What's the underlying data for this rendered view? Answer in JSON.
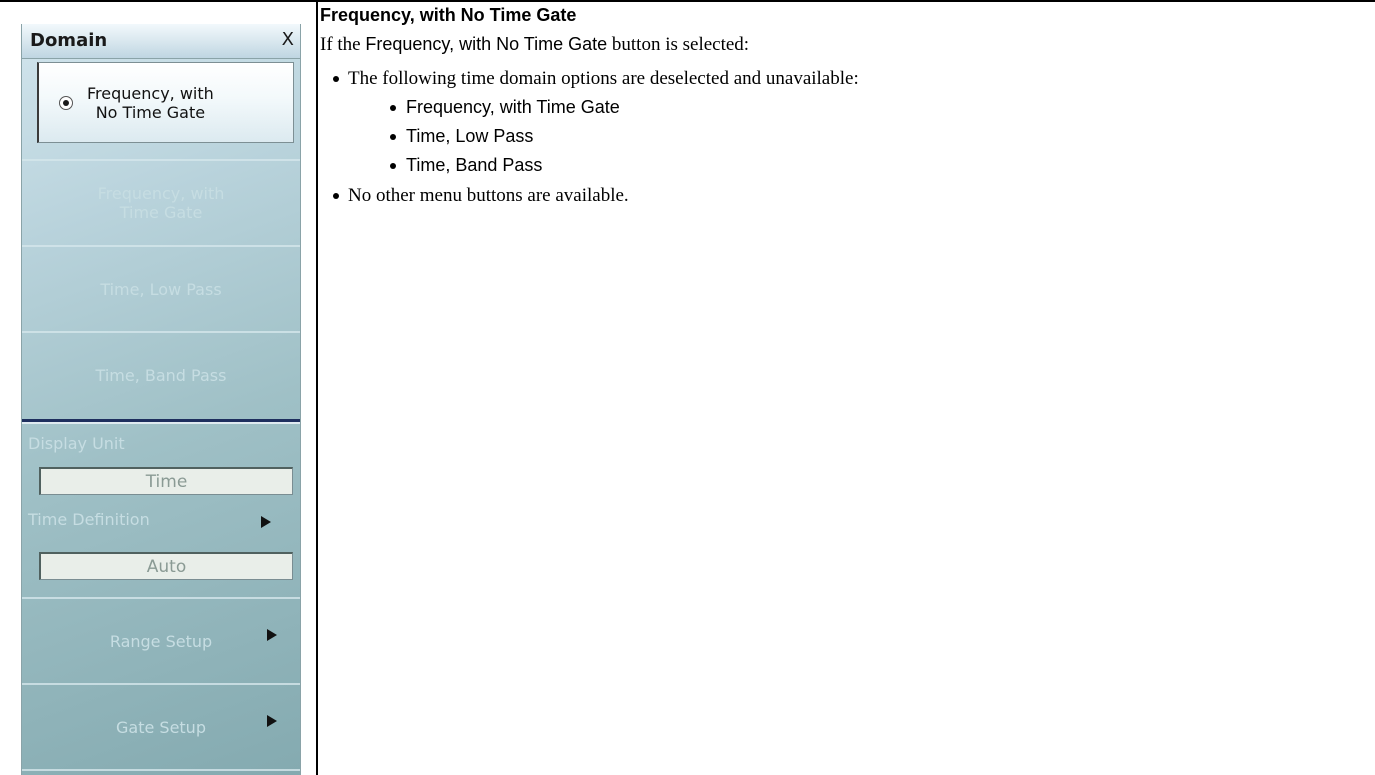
{
  "menu": {
    "title": "Domain",
    "close_label": "X",
    "buttons": [
      {
        "label": "Frequency, with\nNo Time Gate",
        "state": "selected"
      },
      {
        "label": "Frequency, with\nTime Gate",
        "state": "disabled"
      },
      {
        "label": "Time, Low Pass",
        "state": "disabled"
      },
      {
        "label": "Time, Band Pass",
        "state": "disabled"
      }
    ],
    "display_unit_label": "Display Unit",
    "display_unit_value": "Time",
    "time_definition_label": "Time Definition",
    "time_definition_value": "Auto",
    "range_setup_label": "Range Setup",
    "gate_setup_label": "Gate Setup"
  },
  "doc": {
    "heading": "Frequency, with No Time Gate",
    "para_prefix": "If the ",
    "para_button": "Frequency, with No Time Gate",
    "para_suffix": " button is selected:",
    "bullet1": "The following time domain options are deselected and unavailable:",
    "sub_bullets": [
      "Frequency, with Time Gate",
      "Time, Low Pass",
      "Time, Band Pass"
    ],
    "bullet2": "No other menu buttons are available."
  }
}
